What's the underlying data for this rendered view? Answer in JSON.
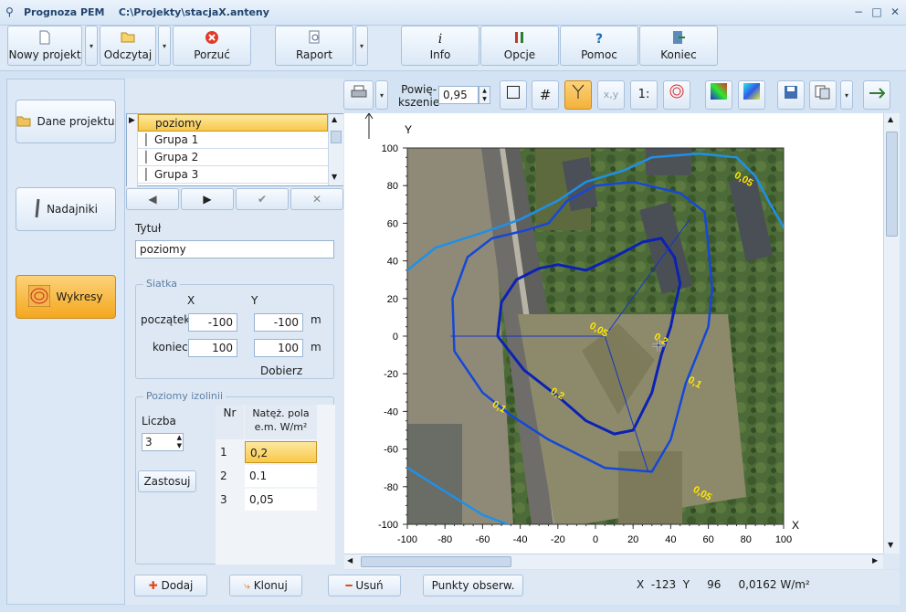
{
  "window": {
    "app_name": "Prognoza PEM",
    "file_path": "C:\\Projekty\\stacjaX.anteny",
    "minimize_glyph": "−",
    "maximize_glyph": "□",
    "close_glyph": "✕"
  },
  "toolbar": {
    "new_project": "Nowy projekt",
    "open": "Odczytaj",
    "abandon": "Porzuć",
    "report": "Raport",
    "info": "Info",
    "options": "Opcje",
    "help": "Pomoc",
    "exit": "Koniec",
    "dropdown_glyph": "▾"
  },
  "left_nav": {
    "project_data": "Dane projektu",
    "transmitters": "Nadajniki",
    "charts": "Wykresy"
  },
  "layers": {
    "items": [
      "poziomy",
      "Grupa 1",
      "Grupa 2",
      "Grupa 3"
    ],
    "selected": 0,
    "nav": {
      "prev": "◀",
      "next": "▶",
      "confirm": "✔",
      "cancel": "✕"
    }
  },
  "form": {
    "title_label": "Tytuł",
    "title_value": "poziomy",
    "grid": {
      "group_label": "Siatka",
      "x_label": "X",
      "y_label": "Y",
      "start_label": "początek",
      "end_label": "koniec",
      "start_x": "-100",
      "start_y": "-100",
      "end_x": "100",
      "end_y": "100",
      "unit_start": "m",
      "unit_end": "m",
      "auto_label": "Dobierz"
    },
    "isolines": {
      "group_label": "Poziomy izolinii",
      "count_label": "Liczba",
      "count_value": "3",
      "apply_button": "Zastosuj",
      "col_nr": "Nr",
      "col_value": "Natęż. pola e.m. W/m²",
      "rows": [
        {
          "nr": "1",
          "value": "0,2"
        },
        {
          "nr": "2",
          "value": "0.1"
        },
        {
          "nr": "3",
          "value": "0,05"
        }
      ]
    }
  },
  "plot_toolbar": {
    "zoom_label": "Powię-\nkszenie",
    "zoom_value": "0,95",
    "scale_label": "1:",
    "xy_label": "x,y"
  },
  "plot": {
    "y_axis_label": "Y",
    "x_axis_label": "X",
    "x_ticks": [
      "-100",
      "-80",
      "-60",
      "-40",
      "-20",
      "0",
      "20",
      "40",
      "60",
      "80",
      "100"
    ],
    "y_ticks": [
      "100",
      "80",
      "60",
      "40",
      "20",
      "0",
      "-20",
      "-40",
      "-60",
      "-80",
      "-100"
    ],
    "contour_labels": [
      {
        "text": "0,05",
        "x": 78,
        "y": 82
      },
      {
        "text": "0,05",
        "x": 56,
        "y": -85
      },
      {
        "text": "0,1",
        "x": -52,
        "y": -39
      },
      {
        "text": "0,1",
        "x": 52,
        "y": -26
      },
      {
        "text": "0,2",
        "x": -21,
        "y": -32
      },
      {
        "text": "0,2",
        "x": 34,
        "y": -3
      },
      {
        "text": "0,05",
        "x": 1,
        "y": 2
      }
    ],
    "colors": {
      "outer": "#1e90e8",
      "middle": "#1548d8",
      "inner": "#0b22b4",
      "labels": "#ffe600"
    }
  },
  "bottom": {
    "add": "Dodaj",
    "clone": "Klonuj",
    "delete": "Usuń",
    "observation_points": "Punkty obserw.",
    "status_x_label": "X",
    "status_x": "-123",
    "status_y_label": "Y",
    "status_y": "96",
    "status_value": "0,0162 W/m²"
  }
}
